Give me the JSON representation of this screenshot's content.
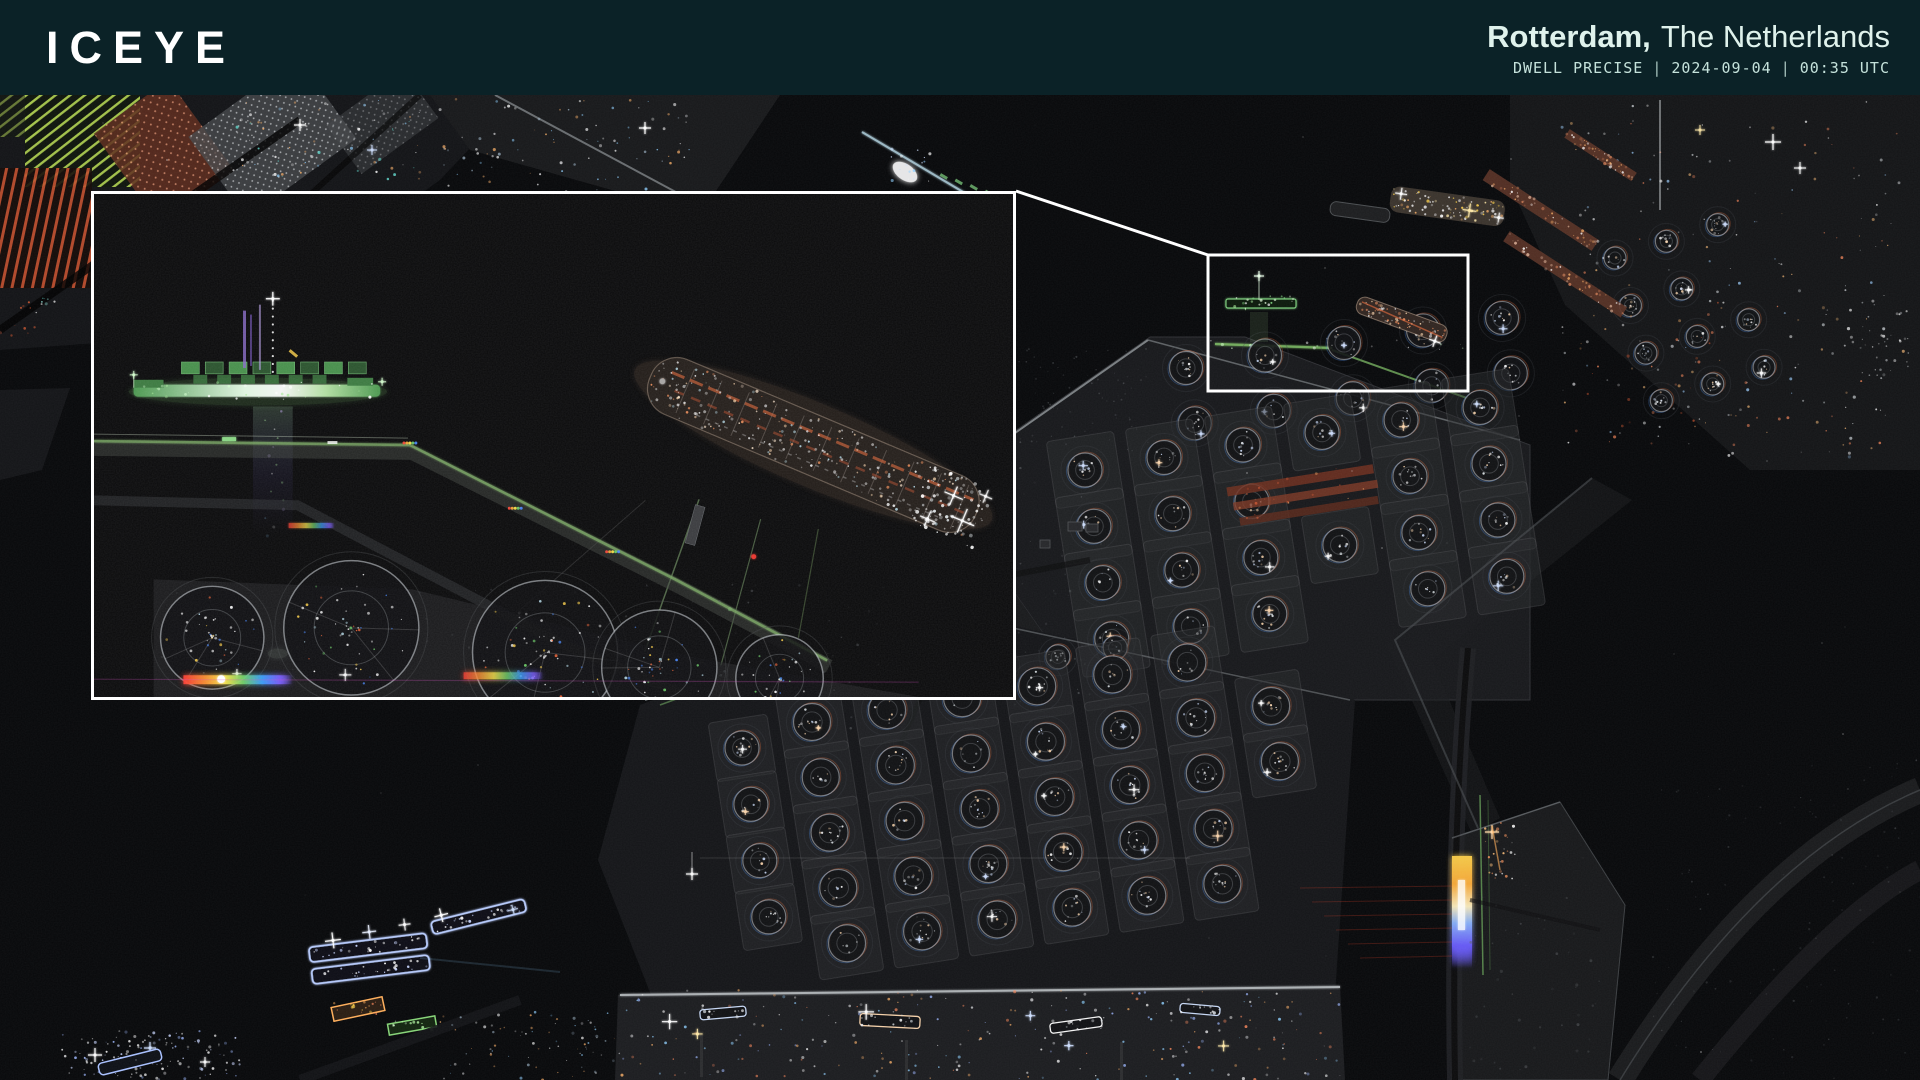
{
  "header": {
    "logo": "ICEYE",
    "location_city": "Rotterdam,",
    "location_country": "The Netherlands",
    "acquisition": {
      "mode": "DWELL PRECISE",
      "date": "2024-09-04",
      "time": "00:35 UTC",
      "separator": "|"
    }
  },
  "theme": {
    "header_bg": "#0b2227",
    "logo_color": "#ffffff",
    "title_color": "#dff2ec",
    "meta_color": "#c5e2db",
    "callout_color": "#ffffff",
    "map_bg": "#07080a"
  }
}
